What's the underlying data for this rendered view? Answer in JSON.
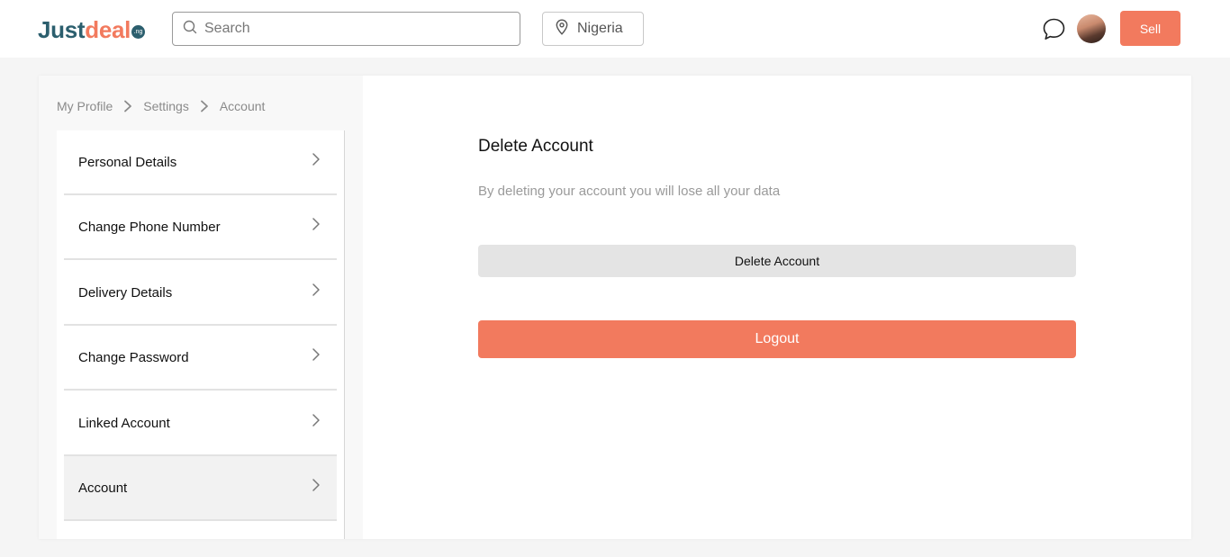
{
  "header": {
    "logo": {
      "part1": "Just",
      "part2": "deal",
      "suffix": ".ng"
    },
    "search": {
      "placeholder": "Search",
      "value": ""
    },
    "location": {
      "label": "Nigeria"
    },
    "sell_label": "Sell",
    "icons": {
      "search": "search-icon",
      "location": "location-pin-icon",
      "chat": "chat-bubble-icon",
      "avatar": "user-avatar"
    }
  },
  "breadcrumb": {
    "items": [
      "My Profile",
      "Settings",
      "Account"
    ],
    "separator_icon": "chevron-right-icon"
  },
  "sidebar": {
    "items": [
      {
        "label": "Personal Details"
      },
      {
        "label": "Change Phone Number"
      },
      {
        "label": "Delivery Details"
      },
      {
        "label": "Change Password"
      },
      {
        "label": "Linked Account"
      },
      {
        "label": "Account",
        "active": true
      }
    ]
  },
  "content": {
    "title": "Delete Account",
    "description": "By deleting your account you will lose all your data",
    "delete_button_label": "Delete Account",
    "logout_button_label": "Logout"
  },
  "colors": {
    "brand_primary": "#f27a5e",
    "brand_dark": "#2c5f6e",
    "page_bg": "#f5f5f5"
  }
}
